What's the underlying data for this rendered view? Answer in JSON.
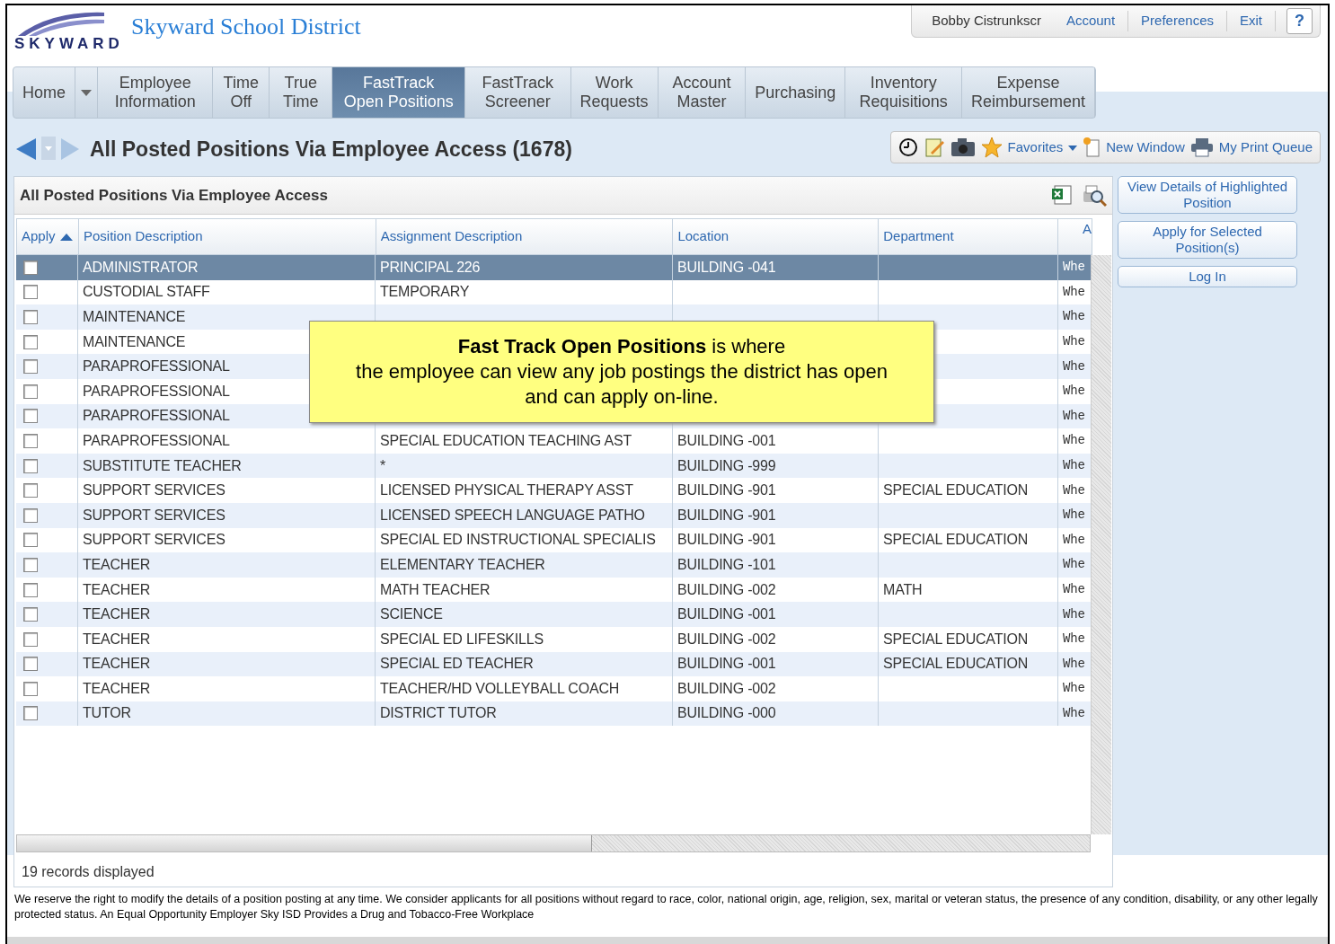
{
  "header": {
    "district": "Skyward School District",
    "logo_text": "SKYWARD",
    "user": "Bobby Cistrunkscr",
    "links": [
      "Account",
      "Preferences",
      "Exit"
    ],
    "help": "?"
  },
  "nav": [
    {
      "label": "Home",
      "selected": false
    },
    {
      "label": "Employee Information",
      "selected": false,
      "dropdown": true
    },
    {
      "label": "Time Off",
      "selected": false
    },
    {
      "label": "True Time",
      "selected": false
    },
    {
      "label": "FastTrack Open Positions",
      "selected": true
    },
    {
      "label": "FastTrack Screener",
      "selected": false
    },
    {
      "label": "Work Requests",
      "selected": false
    },
    {
      "label": "Account Master",
      "selected": false
    },
    {
      "label": "Purchasing",
      "selected": false
    },
    {
      "label": "Inventory Requisitions",
      "selected": false
    },
    {
      "label": "Expense Reimbursement",
      "selected": false
    }
  ],
  "page_title": "All Posted Positions Via Employee Access (1678)",
  "toolbar": {
    "favorites": "Favorites",
    "new_window": "New Window",
    "print_queue": "My Print Queue"
  },
  "grid": {
    "title": "All Posted Positions Via Employee Access",
    "columns": [
      "Apply",
      "Position Description",
      "Assignment Description",
      "Location",
      "Department",
      "A"
    ],
    "rows": [
      {
        "selected": true,
        "checked": false,
        "cells": [
          "",
          "ADMINISTRATOR",
          "PRINCIPAL 226",
          "BUILDING -041",
          "",
          "Whe"
        ]
      },
      {
        "selected": false,
        "checked": false,
        "cells": [
          "",
          "CUSTODIAL STAFF",
          "TEMPORARY",
          "",
          "",
          "Whe"
        ]
      },
      {
        "selected": false,
        "checked": false,
        "cells": [
          "",
          "MAINTENANCE",
          "",
          "",
          "",
          "Whe"
        ]
      },
      {
        "selected": false,
        "checked": false,
        "cells": [
          "",
          "MAINTENANCE",
          "",
          "",
          "",
          "Whe"
        ]
      },
      {
        "selected": false,
        "checked": false,
        "cells": [
          "",
          "PARAPROFESSIONAL",
          "",
          "",
          "",
          "Whe"
        ]
      },
      {
        "selected": false,
        "checked": false,
        "cells": [
          "",
          "PARAPROFESSIONAL",
          "",
          "",
          "",
          "Whe"
        ]
      },
      {
        "selected": false,
        "checked": false,
        "cells": [
          "",
          "PARAPROFESSIONAL",
          "",
          "",
          "",
          "Whe"
        ]
      },
      {
        "selected": false,
        "checked": false,
        "cells": [
          "",
          "PARAPROFESSIONAL",
          "SPECIAL EDUCATION TEACHING AST",
          "BUILDING -001",
          "",
          "Whe"
        ]
      },
      {
        "selected": false,
        "checked": false,
        "cells": [
          "",
          "SUBSTITUTE TEACHER",
          "*",
          "BUILDING -999",
          "",
          "Whe"
        ]
      },
      {
        "selected": false,
        "checked": false,
        "cells": [
          "",
          "SUPPORT SERVICES",
          "LICENSED PHYSICAL THERAPY ASST",
          "BUILDING -901",
          "SPECIAL EDUCATION",
          "Whe"
        ]
      },
      {
        "selected": false,
        "checked": false,
        "cells": [
          "",
          "SUPPORT SERVICES",
          "LICENSED SPEECH LANGUAGE PATHO",
          "BUILDING -901",
          "",
          "Whe"
        ]
      },
      {
        "selected": false,
        "checked": false,
        "cells": [
          "",
          "SUPPORT SERVICES",
          "SPECIAL ED INSTRUCTIONAL SPECIALIS",
          "BUILDING -901",
          "SPECIAL EDUCATION",
          "Whe"
        ]
      },
      {
        "selected": false,
        "checked": false,
        "cells": [
          "",
          "TEACHER",
          "ELEMENTARY TEACHER",
          "BUILDING -101",
          "",
          "Whe"
        ]
      },
      {
        "selected": false,
        "checked": false,
        "cells": [
          "",
          "TEACHER",
          "MATH TEACHER",
          "BUILDING -002",
          "MATH",
          "Whe"
        ]
      },
      {
        "selected": false,
        "checked": false,
        "cells": [
          "",
          "TEACHER",
          "SCIENCE",
          "BUILDING -001",
          "",
          "Whe"
        ]
      },
      {
        "selected": false,
        "checked": false,
        "cells": [
          "",
          "TEACHER",
          "SPECIAL ED LIFESKILLS",
          "BUILDING -002",
          "SPECIAL EDUCATION",
          "Whe"
        ]
      },
      {
        "selected": false,
        "checked": false,
        "cells": [
          "",
          "TEACHER",
          "SPECIAL ED TEACHER",
          "BUILDING -001",
          "SPECIAL EDUCATION",
          "Whe"
        ]
      },
      {
        "selected": false,
        "checked": false,
        "cells": [
          "",
          "TEACHER",
          "TEACHER/HD VOLLEYBALL COACH",
          "BUILDING -002",
          "",
          "Whe"
        ]
      },
      {
        "selected": false,
        "checked": false,
        "cells": [
          "",
          "TUTOR",
          "DISTRICT TUTOR",
          "BUILDING -000",
          "",
          "Whe"
        ]
      }
    ],
    "record_count": "19 records displayed"
  },
  "callout": "**Fast Track Open Positions** is where\nthe employee can view any job postings the district has open\nand can apply on-line.",
  "actions": [
    "View Details of Highlighted Position",
    "Apply for Selected Position(s)",
    "Log In"
  ],
  "disclaimer": "We reserve the right to modify the details of a position posting at any time. We consider applicants for all positions without regard to race, color, national origin, age, religion, sex, marital or veteran status, the presence of any condition, disability, or any other legally protected status. An Equal Opportunity Employer Sky ISD Provides a Drug and Tobacco-Free Workplace"
}
